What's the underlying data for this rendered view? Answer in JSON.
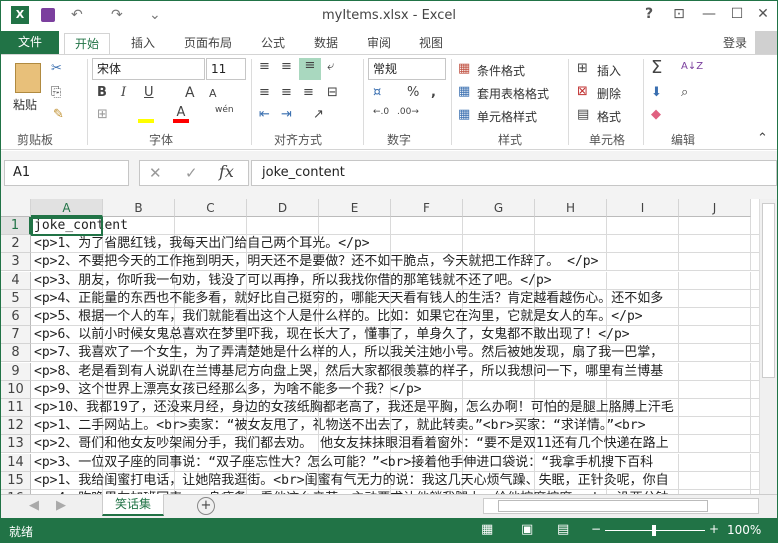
{
  "title_bar": {
    "title": "myItems.xlsx - Excel",
    "help": "?",
    "ribbon_display": "⊡",
    "minimize": "—",
    "maximize": "☐",
    "close": "✕"
  },
  "quick_access": {
    "save_icon": "save-icon",
    "undo": "↶",
    "redo": "↷",
    "customize": "⌄"
  },
  "tabs": [
    "文件",
    "开始",
    "插入",
    "页面布局",
    "公式",
    "数据",
    "审阅",
    "视图"
  ],
  "active_tab": "开始",
  "login": "登录",
  "ribbon": {
    "clipboard": {
      "label": "剪贴板",
      "paste": "粘贴"
    },
    "font": {
      "label": "字体",
      "font_name": "宋体",
      "font_size": "11",
      "bold": "B",
      "italic": "I",
      "underline": "U",
      "grow": "A",
      "shrink": "A",
      "phonetic": "wén",
      "font_color": "#ff0000",
      "fill_color": "#ffff00"
    },
    "alignment": {
      "label": "对齐方式"
    },
    "number": {
      "label": "数字",
      "format": "常规",
      "percent": "%",
      "comma": ","
    },
    "styles": {
      "label": "样式",
      "conditional": "条件格式",
      "table": "套用表格格式",
      "cell_styles": "单元格样式"
    },
    "cells": {
      "label": "单元格",
      "insert": "插入",
      "delete": "删除",
      "format": "格式"
    },
    "editing": {
      "label": "编辑",
      "sum": "Σ"
    }
  },
  "formula_bar": {
    "name_box": "A1",
    "cancel": "✕",
    "enter": "✓",
    "fx": "fx",
    "content": "joke_content"
  },
  "columns": [
    "A",
    "B",
    "C",
    "D",
    "E",
    "F",
    "G",
    "H",
    "I",
    "J"
  ],
  "rows": [
    {
      "n": "1",
      "text": "joke_content"
    },
    {
      "n": "2",
      "text": "<p>1、为了省腮红钱，我每天出门给自己两个耳光。</p>"
    },
    {
      "n": "3",
      "text": "<p>2、不要把今天的工作拖到明天，明天还不是要做？还不如干脆点，今天就把工作辞了。 </p>"
    },
    {
      "n": "4",
      "text": "<p>3、朋友，你听我一句劝，钱没了可以再挣，所以我找你借的那笔钱就不还了吧。</p>"
    },
    {
      "n": "5",
      "text": "<p>4、正能量的东西也不能多看，就好比自己挺穷的，哪能天天看有钱人的生活？肯定越看越伤心。还不如多"
    },
    {
      "n": "6",
      "text": "<p>5、根据一个人的车，我们就能看出这个人是什么样的。比如：如果它在沟里，它就是女人的车。</p>"
    },
    {
      "n": "7",
      "text": "<p>6、以前小时候女鬼总喜欢在梦里吓我，现在长大了，懂事了，单身久了，女鬼都不敢出现了！</p>"
    },
    {
      "n": "8",
      "text": "<p>7、我喜欢了一个女生，为了弄清楚她是什么样的人，所以我关注她小号。然后被她发现，扇了我一巴掌，"
    },
    {
      "n": "9",
      "text": "<p>8、老是看到有人说趴在兰博基尼方向盘上哭，然后大家都很羡慕的样子，所以我想问一下，哪里有兰博基"
    },
    {
      "n": "10",
      "text": "<p>9、这个世界上漂亮女孩已经那么多，为啥不能多一个我？</p>"
    },
    {
      "n": "11",
      "text": "<p>10、我都19了，还没来月经，身边的女孩纸胸都老高了，我还是平胸，怎么办啊！可怕的是腿上胳膊上汗毛"
    },
    {
      "n": "12",
      "text": "<p>1、二手网站上。<br>卖家：“被女友甩了，礼物送不出去了，就此转卖。”<br>买家：“求详情。”<br>"
    },
    {
      "n": "13",
      "text": "<p>2、哥们和他女友吵架闹分手，我们都去劝。 他女友抹抹眼泪看着窗外：“要不是双11还有几个快递在路上"
    },
    {
      "n": "14",
      "text": "<p>3、一位双子座的同事说：“双子座忘性大？怎么可能？”<br>接着他手伸进口袋说：“我拿手机搜下百科"
    },
    {
      "n": "15",
      "text": "<p>1、我给闺蜜打电话，让她陪我逛街。<br>闺蜜有气无力的说：我这几天心烦气躁、失眠，正针灸呢，你自"
    },
    {
      "n": "16",
      "text": "<p>4、昨晚男友加班回来，一身疲惫，看他这么辛苦，主动要求让他躺我腿上，给他按摩按摩。<br>没两分钟"
    }
  ],
  "sheet_tabs": [
    "笑话集"
  ],
  "status_bar": {
    "ready": "就绪",
    "zoom": "100%"
  }
}
